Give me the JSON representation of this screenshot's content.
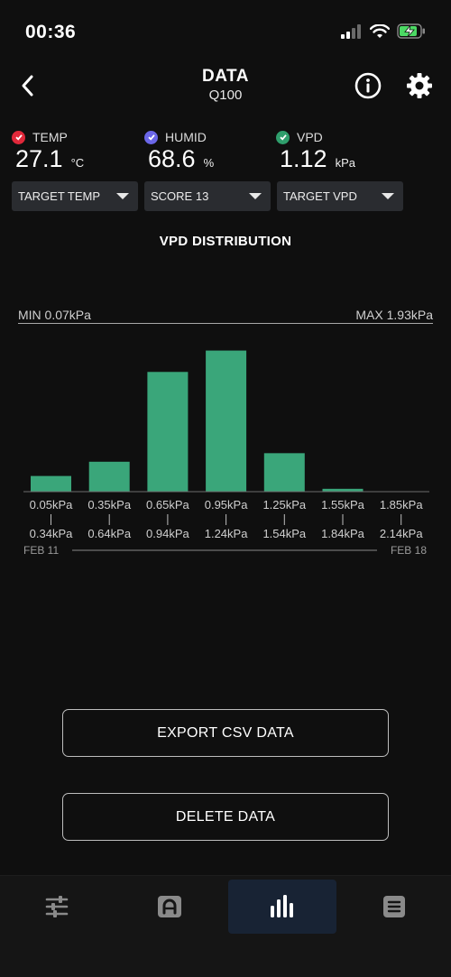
{
  "status_bar": {
    "time": "00:36"
  },
  "nav": {
    "title": "DATA",
    "subtitle": "Q100"
  },
  "metrics": [
    {
      "label": "TEMP",
      "value": "27.1",
      "unit": "°C",
      "dot_color": "#e0283a"
    },
    {
      "label": "HUMID",
      "value": "68.6",
      "unit": "%",
      "dot_color": "#6b67e8"
    },
    {
      "label": "VPD",
      "value": "1.12",
      "unit": "kPa",
      "dot_color": "#2f9e6c"
    }
  ],
  "dropdowns": [
    {
      "label": "TARGET TEMP"
    },
    {
      "label": "SCORE 13"
    },
    {
      "label": "TARGET VPD"
    }
  ],
  "section_title": "VPD DISTRIBUTION",
  "range": {
    "min": "MIN 0.07kPa",
    "max": "MAX 1.93kPa"
  },
  "chart_data": {
    "type": "bar",
    "title": "VPD DISTRIBUTION",
    "categories_low": [
      "0.05kPa",
      "0.35kPa",
      "0.65kPa",
      "0.95kPa",
      "1.25kPa",
      "1.55kPa",
      "1.85kPa"
    ],
    "categories_high": [
      "0.34kPa",
      "0.64kPa",
      "0.94kPa",
      "1.24kPa",
      "1.54kPa",
      "1.84kPa",
      "2.14kPa"
    ],
    "values": [
      11,
      21,
      84,
      99,
      27,
      2,
      0
    ],
    "ylim": [
      0,
      100
    ],
    "bar_color": "#3aa67a",
    "date_start": "FEB 11",
    "date_end": "FEB 18"
  },
  "buttons": {
    "export": "EXPORT CSV DATA",
    "delete": "DELETE DATA"
  },
  "tabs": [
    {
      "icon": "sliders-icon",
      "active": false
    },
    {
      "icon": "arch-icon",
      "active": false
    },
    {
      "icon": "bar-chart-icon",
      "active": true
    },
    {
      "icon": "menu-icon",
      "active": false
    }
  ]
}
